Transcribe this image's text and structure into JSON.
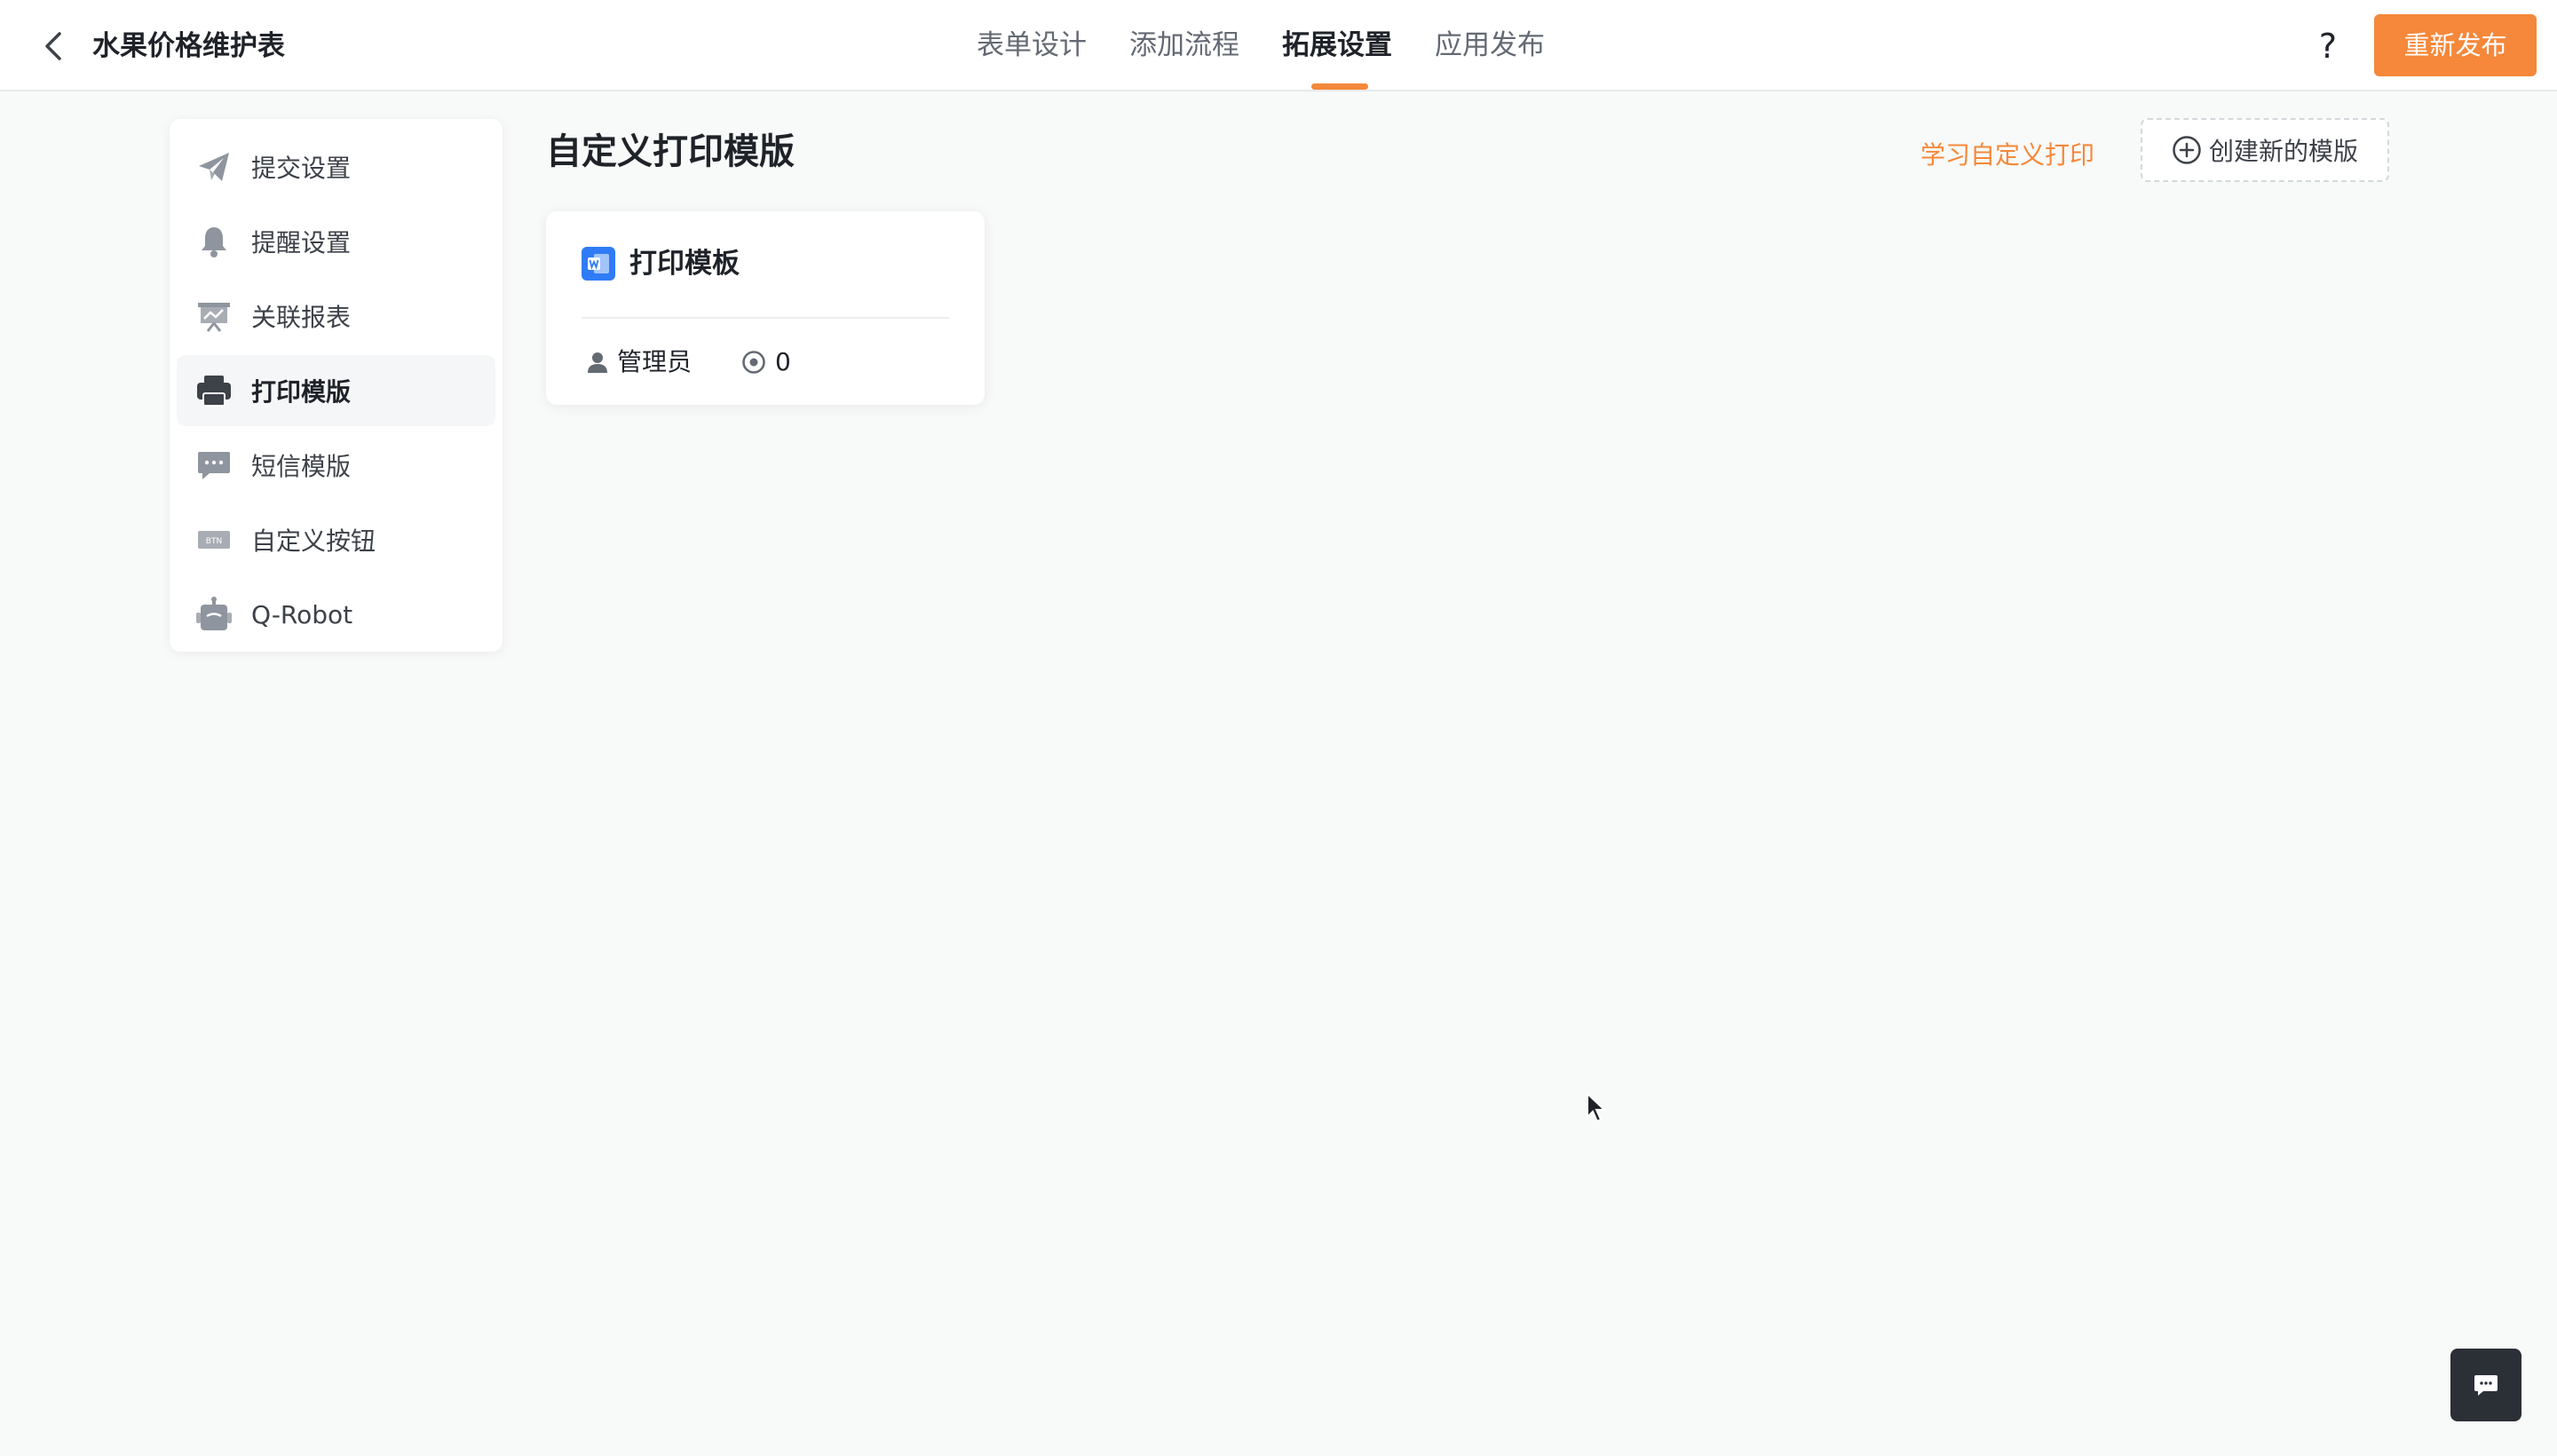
{
  "header": {
    "app_title": "水果价格维护表",
    "tabs": [
      {
        "label": "表单设计",
        "active": false
      },
      {
        "label": "添加流程",
        "active": false
      },
      {
        "label": "拓展设置",
        "active": true
      },
      {
        "label": "应用发布",
        "active": false
      }
    ],
    "help_label": "?",
    "republish_label": "重新发布"
  },
  "sidebar": {
    "items": [
      {
        "label": "提交设置",
        "icon": "send-icon",
        "active": false
      },
      {
        "label": "提醒设置",
        "icon": "bell-icon",
        "active": false
      },
      {
        "label": "关联报表",
        "icon": "report-icon",
        "active": false
      },
      {
        "label": "打印模版",
        "icon": "printer-icon",
        "active": true
      },
      {
        "label": "短信模版",
        "icon": "message-icon",
        "active": false
      },
      {
        "label": "自定义按钮",
        "icon": "btn-icon",
        "active": false
      },
      {
        "label": "Q-Robot",
        "icon": "robot-icon",
        "active": false
      }
    ]
  },
  "main": {
    "title": "自定义打印模版",
    "learn_link": "学习自定义打印",
    "create_label": "创建新的模版",
    "templates": [
      {
        "name": "打印模板",
        "owner": "管理员",
        "count": "0",
        "icon": "word-doc-icon"
      }
    ]
  },
  "colors": {
    "accent": "#f5883a",
    "doc_icon_blue": "#2f7cf6",
    "chat_button": "#2b2f36"
  }
}
